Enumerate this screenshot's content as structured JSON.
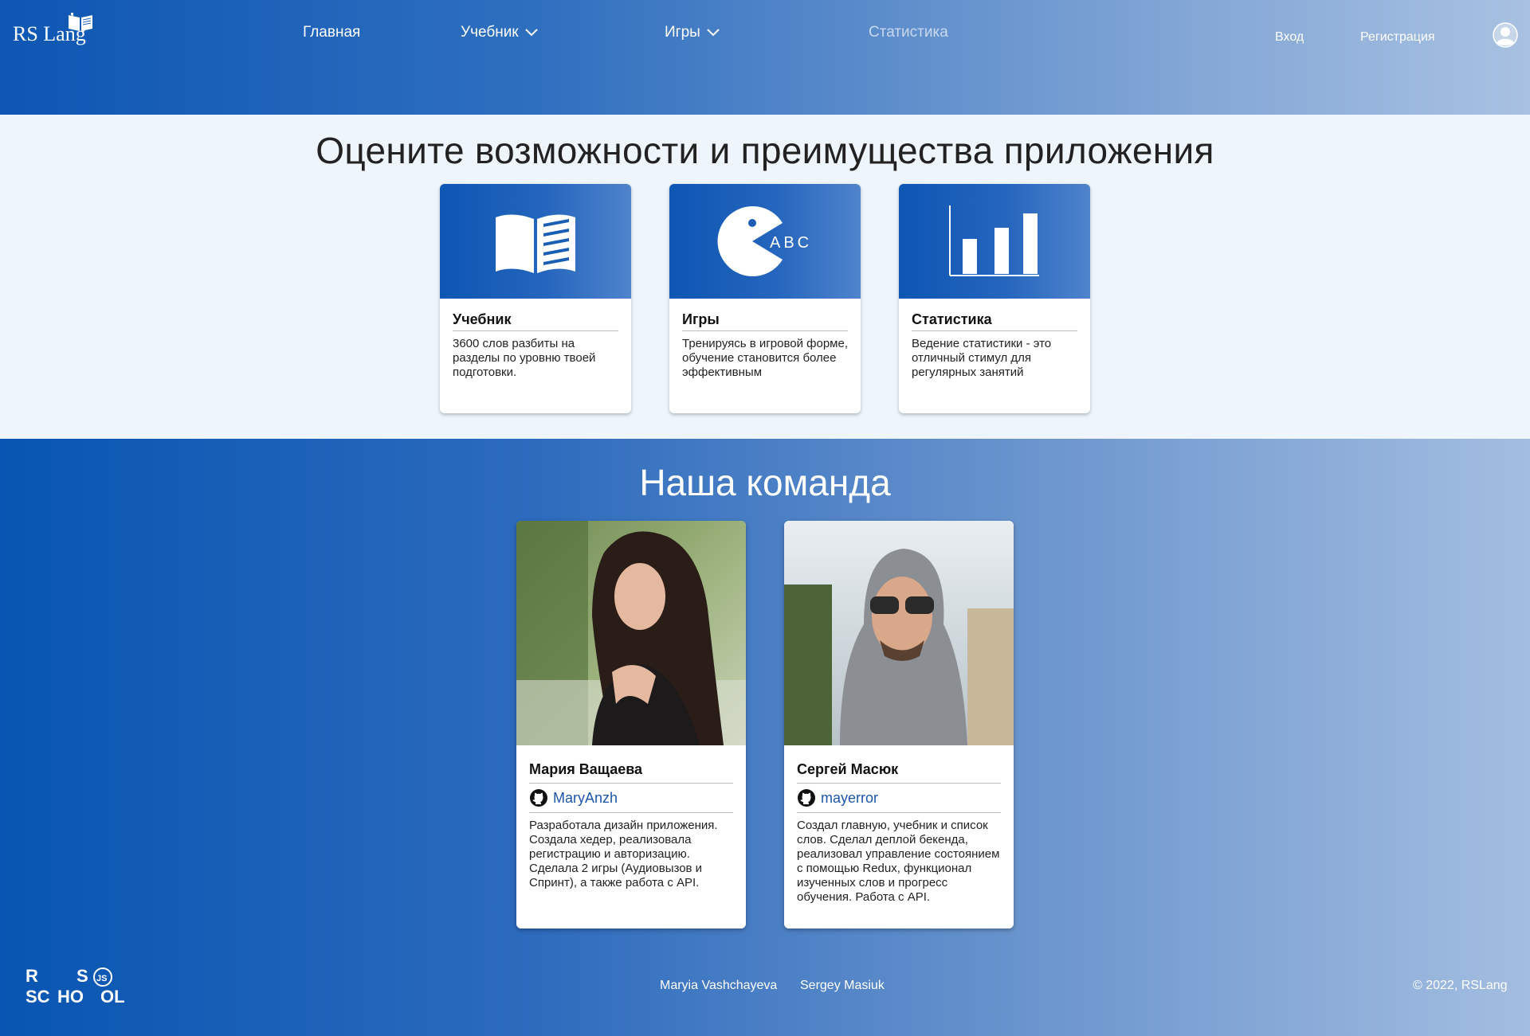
{
  "header": {
    "logo_text": "RS Lang",
    "nav": [
      {
        "label": "Главная"
      },
      {
        "label": "Учебник"
      },
      {
        "label": "Игры"
      },
      {
        "label": "Статистика"
      }
    ],
    "login_label": "Вход",
    "register_label": "Регистрация"
  },
  "features": {
    "title": "Оцените возможности и преимущества приложения",
    "cards": [
      {
        "icon": "book-icon",
        "title": "Учебник",
        "text": "3600 слов разбиты на разделы по уровню твоей подготовки."
      },
      {
        "icon": "pacman-abc-icon",
        "title": "Игры",
        "icon_text": "ABC",
        "text": "Тренируясь в игровой форме, обучение становится более эффективным"
      },
      {
        "icon": "bar-chart-icon",
        "title": "Статистика",
        "text": "Ведение статистики - это отличный стимул для регулярных занятий"
      }
    ]
  },
  "team": {
    "title": "Наша команда",
    "members": [
      {
        "name": "Мария Ващаева",
        "github": "MaryAnzh",
        "text": "Разработала дизайн приложения. Создала хедер, реализовала регистрацию и авторизацию. Сделала 2 игры (Аудиовызов и Спринт), а также работа с API."
      },
      {
        "name": "Сергей Масюк",
        "github": "mayerror",
        "text": "Создал главную, учебник и список слов. Сделал деплой бекенда, реализовал управление состоянием с помощью Redux, функционал изученных слов и прогресс обучения. Работа с API."
      }
    ]
  },
  "footer": {
    "logo_lines": [
      "R",
      "S",
      "JS",
      "SC",
      "HO",
      "OL"
    ],
    "links": [
      "Maryia Vashchayeva",
      "Sergey Masiuk"
    ],
    "copyright": "© 2022, RSLang"
  },
  "colors": {
    "brand_blue": "#0d56b3",
    "link_blue": "#1c55a8",
    "features_bg": "#eef5fc"
  }
}
